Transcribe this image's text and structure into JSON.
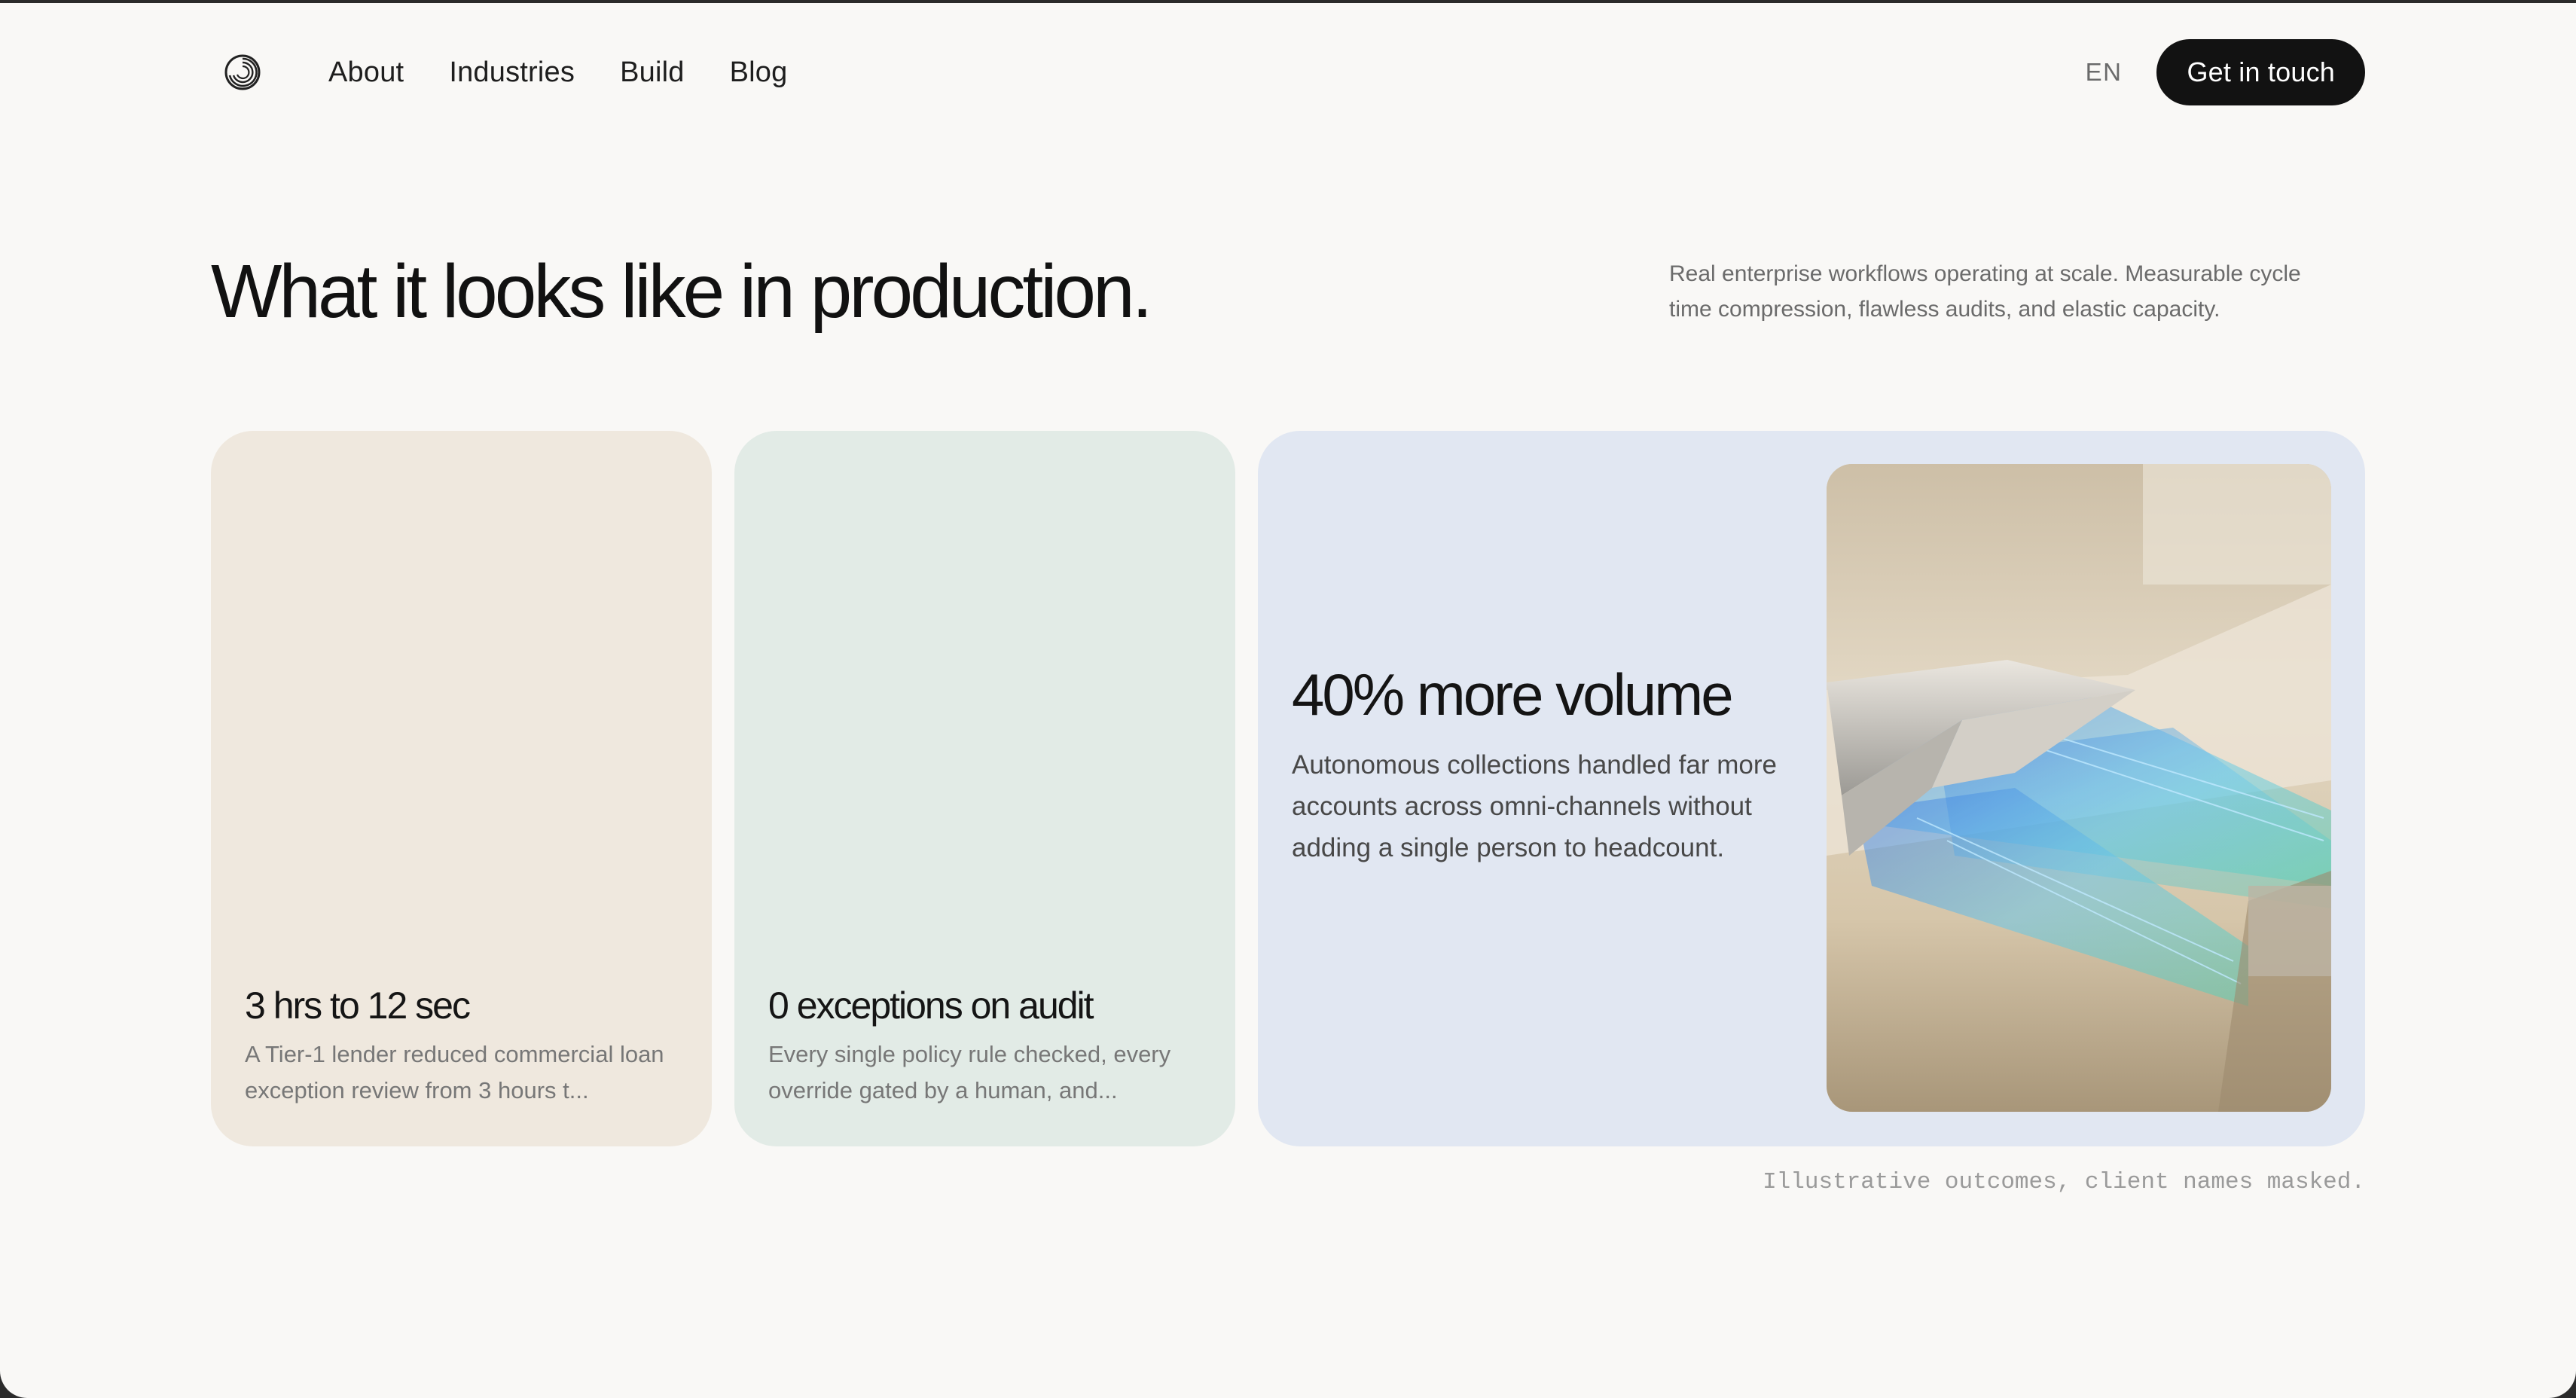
{
  "nav": {
    "logo_icon": "swirl-logo-icon",
    "links": [
      "About",
      "Industries",
      "Build",
      "Blog"
    ],
    "language": "EN",
    "cta_label": "Get in touch"
  },
  "hero": {
    "headline": "What it looks like in production.",
    "subcopy": "Real enterprise workflows operating at scale. Measurable cycle time compression, flawless audits, and elastic capacity."
  },
  "cards": [
    {
      "stat": "3 hrs to 12 sec",
      "description": "A Tier-1 lender reduced commercial loan exception review from 3 hours t...",
      "color": "#efe8de"
    },
    {
      "stat": "0 exceptions on audit",
      "description": "Every single policy rule checked, every override gated by a human, and...",
      "color": "#e2ebe6"
    }
  ],
  "featured": {
    "stat": "40% more volume",
    "description": "Autonomous collections handled far more accounts across omni-channels without adding a single person to headcount.",
    "color": "#e1e7f2",
    "image_icon": "light-channels-render"
  },
  "footnote": "Illustrative outcomes, client names masked."
}
